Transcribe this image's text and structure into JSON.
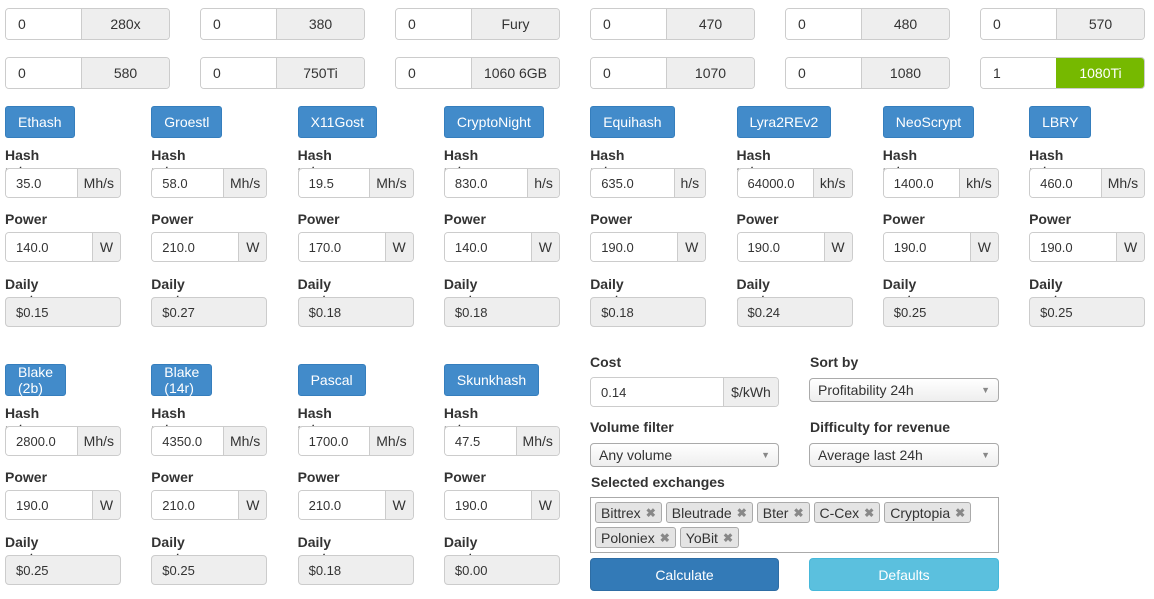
{
  "gpus": [
    {
      "count": "0",
      "model": "280x"
    },
    {
      "count": "0",
      "model": "380"
    },
    {
      "count": "0",
      "model": "Fury"
    },
    {
      "count": "0",
      "model": "470"
    },
    {
      "count": "0",
      "model": "480"
    },
    {
      "count": "0",
      "model": "570"
    },
    {
      "count": "0",
      "model": "580"
    },
    {
      "count": "0",
      "model": "750Ti"
    },
    {
      "count": "0",
      "model": "1060 6GB"
    },
    {
      "count": "0",
      "model": "1070"
    },
    {
      "count": "0",
      "model": "1080"
    },
    {
      "count": "1",
      "model": "1080Ti",
      "selected": true
    }
  ],
  "labels": {
    "hash": "Hash rate",
    "power": "Power",
    "cost": "Daily cost"
  },
  "algorithms": [
    {
      "name": "Ethash",
      "hash": "35.0",
      "unit": "Mh/s",
      "power": "140.0",
      "punit": "W",
      "daily": "$0.15"
    },
    {
      "name": "Groestl",
      "hash": "58.0",
      "unit": "Mh/s",
      "power": "210.0",
      "punit": "W",
      "daily": "$0.27"
    },
    {
      "name": "X11Gost",
      "hash": "19.5",
      "unit": "Mh/s",
      "power": "170.0",
      "punit": "W",
      "daily": "$0.18"
    },
    {
      "name": "CryptoNight",
      "hash": "830.0",
      "unit": "h/s",
      "power": "140.0",
      "punit": "W",
      "daily": "$0.18"
    },
    {
      "name": "Equihash",
      "hash": "635.0",
      "unit": "h/s",
      "power": "190.0",
      "punit": "W",
      "daily": "$0.18"
    },
    {
      "name": "Lyra2REv2",
      "hash": "64000.0",
      "unit": "kh/s",
      "power": "190.0",
      "punit": "W",
      "daily": "$0.24"
    },
    {
      "name": "NeoScrypt",
      "hash": "1400.0",
      "unit": "kh/s",
      "power": "190.0",
      "punit": "W",
      "daily": "$0.25"
    },
    {
      "name": "LBRY",
      "hash": "460.0",
      "unit": "Mh/s",
      "power": "190.0",
      "punit": "W",
      "daily": "$0.25"
    },
    {
      "name": "Blake (2b)",
      "hash": "2800.0",
      "unit": "Mh/s",
      "power": "190.0",
      "punit": "W",
      "daily": "$0.25"
    },
    {
      "name": "Blake (14r)",
      "hash": "4350.0",
      "unit": "Mh/s",
      "power": "210.0",
      "punit": "W",
      "daily": "$0.25"
    },
    {
      "name": "Pascal",
      "hash": "1700.0",
      "unit": "Mh/s",
      "power": "210.0",
      "punit": "W",
      "daily": "$0.18"
    },
    {
      "name": "Skunkhash",
      "hash": "47.5",
      "unit": "Mh/s",
      "power": "190.0",
      "punit": "W",
      "daily": "$0.00"
    }
  ],
  "settings": {
    "cost_label": "Cost",
    "cost_value": "0.14",
    "cost_unit": "$/kWh",
    "sort_label": "Sort by",
    "sort_value": "Profitability 24h",
    "volume_label": "Volume filter",
    "volume_value": "Any volume",
    "difficulty_label": "Difficulty for revenue",
    "difficulty_value": "Average last 24h",
    "exchanges_label": "Selected exchanges",
    "exchanges": [
      "Bittrex",
      "Bleutrade",
      "Bter",
      "C-Cex",
      "Cryptopia",
      "Poloniex",
      "YoBit"
    ],
    "calculate": "Calculate",
    "defaults": "Defaults"
  },
  "colors": {
    "primary": "#428bca",
    "selected_gpu": "#76b900",
    "calculate": "#337ab7",
    "defaults": "#5bc0de"
  }
}
